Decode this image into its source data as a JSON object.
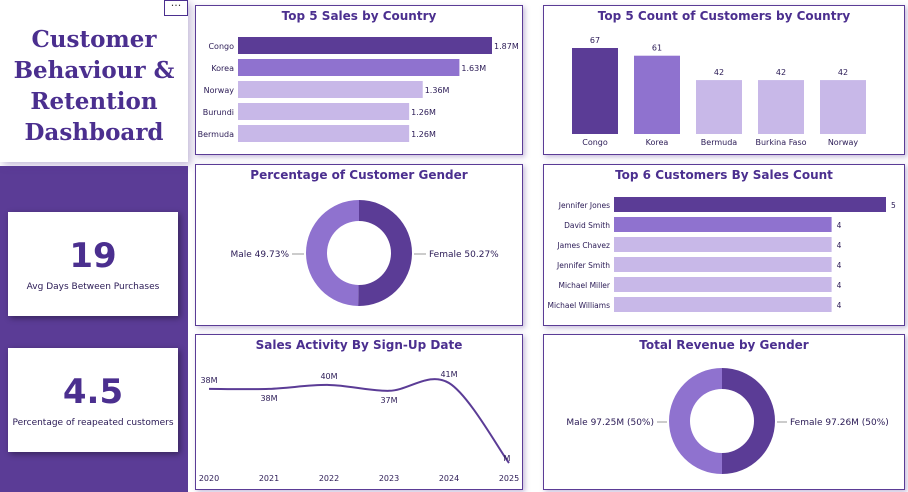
{
  "dashboard_title": [
    "Customer",
    "Behaviour &",
    "Retention",
    "Dashboard"
  ],
  "more_button": "···",
  "kpi1": {
    "value": "19",
    "label": "Avg Days Between Purchases"
  },
  "kpi2": {
    "value": "4.5",
    "label": "Percentage  of reapeated customers"
  },
  "colors": {
    "dark": "#5b3c96",
    "mid": "#8f72cf",
    "light": "#c8b8e8",
    "accent": "#4b2f8f"
  },
  "chart_data": [
    {
      "id": "top5_sales",
      "type": "bar",
      "orientation": "horizontal",
      "title": "Top 5 Sales by Country",
      "categories": [
        "Congo",
        "Korea",
        "Norway",
        "Burundi",
        "Bermuda"
      ],
      "values": [
        1.87,
        1.63,
        1.36,
        1.26,
        1.26
      ],
      "labels": [
        "1.87M",
        "1.63M",
        "1.36M",
        "1.26M",
        "1.26M"
      ]
    },
    {
      "id": "top5_customers",
      "type": "bar",
      "title": "Top 5 Count of Customers by Country",
      "categories": [
        "Congo",
        "Korea",
        "Bermuda",
        "Burkina Faso",
        "Norway"
      ],
      "values": [
        67,
        61,
        42,
        42,
        42
      ],
      "labels": [
        "67",
        "61",
        "42",
        "42",
        "42"
      ]
    },
    {
      "id": "gender_pct",
      "type": "pie",
      "title": "Percentage of Customer Gender",
      "slices": [
        {
          "name": "Female",
          "value": 50.27,
          "label": "Female 50.27%"
        },
        {
          "name": "Male",
          "value": 49.73,
          "label": "Male 49.73%"
        }
      ]
    },
    {
      "id": "top6_customers",
      "type": "bar",
      "orientation": "horizontal",
      "title": "Top 6 Customers By Sales Count",
      "categories": [
        "Jennifer Jones",
        "David Smith",
        "James Chavez",
        "Jennifer Smith",
        "Michael Miller",
        "Michael Williams"
      ],
      "values": [
        5,
        4,
        4,
        4,
        4,
        4
      ],
      "labels": [
        "5",
        "4",
        "4",
        "4",
        "4",
        "4"
      ]
    },
    {
      "id": "sales_activity",
      "type": "line",
      "title": "Sales Activity By Sign-Up Date",
      "x": [
        "2020",
        "2021",
        "2022",
        "2023",
        "2024",
        "2025"
      ],
      "values": [
        38,
        38,
        40,
        37,
        41,
        0
      ],
      "labels": [
        "38M",
        "38M",
        "40M",
        "37M",
        "41M",
        "M"
      ]
    },
    {
      "id": "revenue_gender",
      "type": "pie",
      "title": "Total Revenue by Gender",
      "slices": [
        {
          "name": "Female",
          "value": 97.26,
          "label": "Female 97.26M (50%)"
        },
        {
          "name": "Male",
          "value": 97.25,
          "label": "Male 97.25M (50%)"
        }
      ]
    }
  ]
}
